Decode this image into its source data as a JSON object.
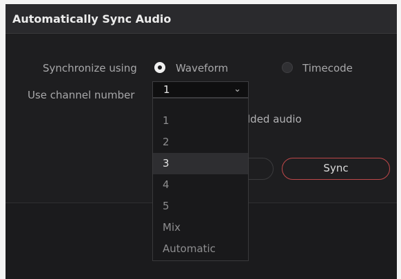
{
  "dialog": {
    "title": "Automatically Sync Audio",
    "sync_using_label": "Synchronize using",
    "options": [
      {
        "label": "Waveform",
        "selected": true
      },
      {
        "label": "Timecode",
        "selected": false
      }
    ],
    "channel_label": "Use channel number",
    "channel_value": "1",
    "embedded_audio_text": "lded audio",
    "sync_button": "Sync"
  },
  "dropdown": {
    "items": [
      "1",
      "2",
      "3",
      "4",
      "5",
      "Mix",
      "Automatic"
    ],
    "highlighted": "3"
  },
  "colors": {
    "background": "#1b1b1d",
    "accent_border": "#c0484a"
  }
}
